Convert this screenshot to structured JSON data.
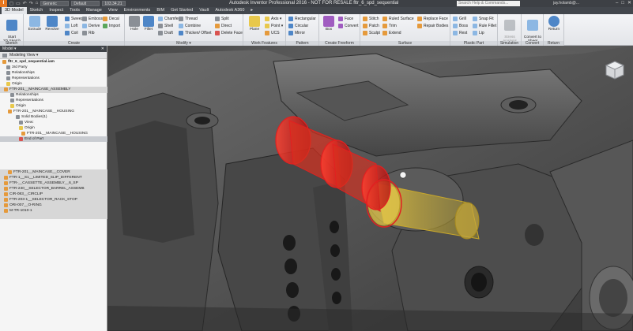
{
  "titlebar": {
    "logo": "I",
    "quick_access": [
      "◻",
      "▭",
      "↶",
      "↷",
      "⌂"
    ],
    "material_field": "Generic",
    "appearance_field": "Default",
    "file_field": "103.34.21",
    "title": "Autodesk Inventor Professional 2016 - NOT FOR RESALE    fltr_6_spd_sequential",
    "help_placeholder": "Search Help & Commands...",
    "user": "jay.holamb@...",
    "window_buttons": [
      "–",
      "□",
      "✕"
    ]
  },
  "ribbon_tabs": [
    "3D Model",
    "Sketch",
    "Inspect",
    "Tools",
    "Manage",
    "View",
    "Environments",
    "BIM",
    "Get Started",
    "Vault",
    "Autodesk A360",
    "▸"
  ],
  "active_tab": "3D Model",
  "ribbon": {
    "groups": [
      {
        "title": "Sketch"
      },
      {
        "title": "Create"
      },
      {
        "title": "Modify ▾"
      },
      {
        "title": "Work Features"
      },
      {
        "title": "Pattern"
      },
      {
        "title": "Create Freeform"
      },
      {
        "title": "Surface"
      },
      {
        "title": "Plastic Part"
      },
      {
        "title": "Simulation"
      },
      {
        "title": "Convert"
      },
      {
        "title": "Return"
      }
    ],
    "start_sketch": "Start\n2D Sketch",
    "extrude": "Extrude",
    "revolve": "Revolve",
    "sweep": "Sweep",
    "loft": "Loft",
    "coil": "Coil",
    "emboss": "Emboss",
    "derive": "Derive",
    "rib": "Rib",
    "decal": "Decal",
    "import": "Import",
    "hole": "Hole",
    "fillet": "Fillet",
    "chamfer": "Chamfer",
    "shell": "Shell",
    "draft": "Draft",
    "thread": "Thread",
    "combine": "Combine",
    "thicken": "Thicken/ Offset",
    "split": "Split",
    "direct": "Direct",
    "delete_face": "Delete Face",
    "plane": "Plane",
    "axis": "Axis ▾",
    "point": "Point ▾",
    "ucs": "UCS",
    "rectangular": "Rectangular",
    "circular": "Circular",
    "mirror": "Mirror",
    "box": "Box",
    "face": "Face",
    "convert": "Convert",
    "stitch": "Stitch",
    "patch": "Patch",
    "sculpt": "Sculpt",
    "ruled_surface": "Ruled Surface",
    "trim": "Trim",
    "extend": "Extend",
    "replace_face": "Replace Face",
    "repair_bodies": "Repair Bodies",
    "grill": "Grill",
    "boss": "Boss",
    "rest": "Rest",
    "snap_fit": "Snap Fit",
    "rule_fillet": "Rule Fillet",
    "lip": "Lip",
    "stress_analysis": "Stress\nAnalysis",
    "convert_sheet": "Convert to\nSheet Metal",
    "return": "Return"
  },
  "browser": {
    "header": "Model ▾",
    "close": "✕",
    "view_label": "Modeling View ▾",
    "nodes": [
      {
        "label": "fltr_6_spd_sequential.iam",
        "bold": true,
        "level": 0
      },
      {
        "label": "3rd Party",
        "level": 1
      },
      {
        "label": "Relationships",
        "level": 1
      },
      {
        "label": "Representations",
        "level": 1
      },
      {
        "label": "Origin",
        "level": 1
      },
      {
        "label": "FTR-201__MAINCASE_ASSEMBLY",
        "level": 1
      },
      {
        "label": "Relationships",
        "level": 2
      },
      {
        "label": "Representations",
        "level": 2
      },
      {
        "label": "Origin",
        "level": 2
      },
      {
        "label": "FTR-201__MAINCASE__HOUSING",
        "level": 2
      },
      {
        "label": "Solid Bodies(1)",
        "level": 3
      },
      {
        "label": "View:",
        "level": 3
      },
      {
        "label": "Origin",
        "level": 3
      },
      {
        "label": "FTR-201__MAINCASE__HOUSING",
        "level": 4
      },
      {
        "label": "End of Part",
        "level": 3
      },
      {
        "label": "FTR-201__MAINCASE__COVER",
        "level": 2
      },
      {
        "label": "FTR-1__S1__LIMITED_SLIP_DIFFERENT",
        "level": 1
      },
      {
        "label": "FTR-__CASSETTE_ASSEMBLY__6_SP",
        "level": 1
      },
      {
        "label": "FTR-240__SELECTOR_BARREL_ASSEMB",
        "level": 1
      },
      {
        "label": "CIR-083__CIRCLIP",
        "level": 1
      },
      {
        "label": "FTR-203-1__SELECTOR_RACK_STOP",
        "level": 1
      },
      {
        "label": "ORI-007__O-RING",
        "level": 1
      },
      {
        "label": "M-TR-1010-1",
        "level": 1
      }
    ]
  },
  "viewport": {
    "label": "3D model viewport"
  },
  "colors": {
    "accent": "#e8771e",
    "titlebar": "#3d4045",
    "selection_red": "#e22020",
    "selection_yellow": "#e0c040"
  }
}
